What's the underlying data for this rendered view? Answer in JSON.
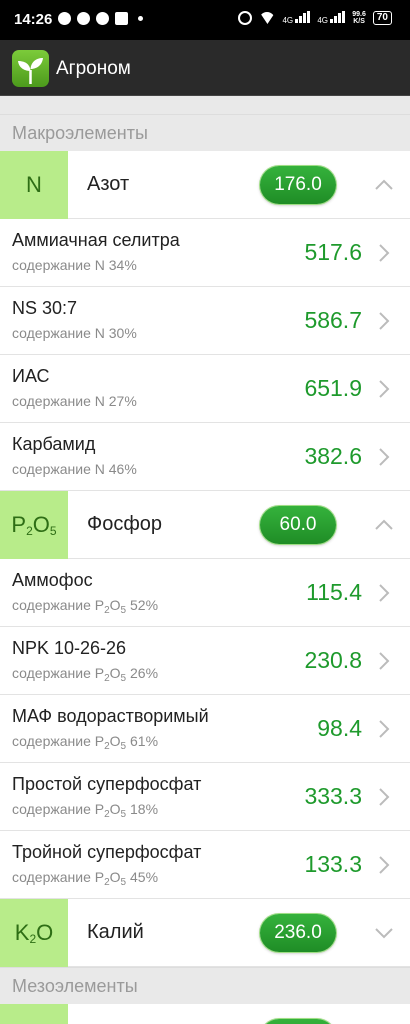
{
  "status_bar": {
    "time": "14:26",
    "net1": "4G",
    "net2": "4G",
    "speed_value": "99.6",
    "speed_unit": "K/S",
    "battery": "70"
  },
  "app": {
    "title": "Агроном"
  },
  "sections": {
    "macro_header": "Макроэлементы",
    "meso_header": "Мезоэлементы"
  },
  "nitrogen": {
    "symbol": "N",
    "name": "Азот",
    "total": "176.0",
    "fertilizers": [
      {
        "name": "Аммиачная селитра",
        "content_prefix": "содержание N",
        "content_pct": "34%",
        "value": "517.6"
      },
      {
        "name": "NS 30:7",
        "content_prefix": "содержание N",
        "content_pct": "30%",
        "value": "586.7"
      },
      {
        "name": "ИАС",
        "content_prefix": "содержание N",
        "content_pct": "27%",
        "value": "651.9"
      },
      {
        "name": "Карбамид",
        "content_prefix": "содержание N",
        "content_pct": "46%",
        "value": "382.6"
      }
    ]
  },
  "phosphorus": {
    "symbol_main": "P",
    "symbol_sub1": "2",
    "symbol_o": "O",
    "symbol_sub2": "5",
    "name": "Фосфор",
    "total": "60.0",
    "fertilizers": [
      {
        "name": "Аммофос",
        "content_prefix": "содержание P",
        "content_pct": "52%",
        "value": "115.4"
      },
      {
        "name": "NPK 10-26-26",
        "content_prefix": "содержание P",
        "content_pct": "26%",
        "value": "230.8"
      },
      {
        "name": "МАФ водорастворимый",
        "content_prefix": "содержание P",
        "content_pct": "61%",
        "value": "98.4"
      },
      {
        "name": "Простой суперфосфат",
        "content_prefix": "содержание P",
        "content_pct": "18%",
        "value": "333.3"
      },
      {
        "name": "Тройной суперфосфат",
        "content_prefix": "содержание P",
        "content_pct": "45%",
        "value": "133.3"
      }
    ],
    "sub_2": "2",
    "letter_o": "O",
    "sub_5": "5"
  },
  "potassium": {
    "symbol_main": "K",
    "symbol_sub": "2",
    "symbol_o": "O",
    "name": "Калий",
    "total": "236.0"
  },
  "colors": {
    "accent_green": "#1e9a2c",
    "symbol_bg": "#b8ec8a",
    "appbar": "#2a2a2a"
  }
}
